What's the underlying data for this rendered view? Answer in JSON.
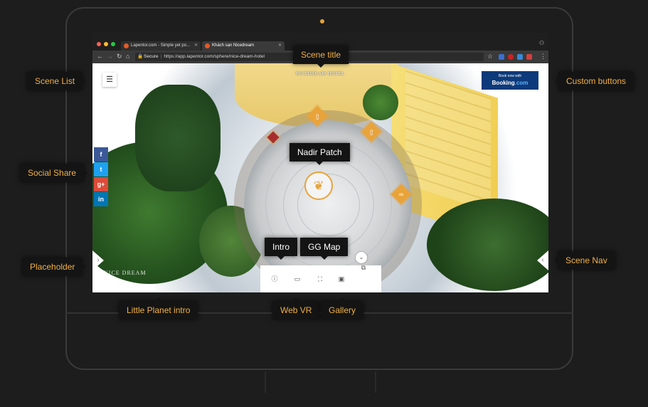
{
  "browser": {
    "tabs": [
      {
        "title": "Lapentor.com - Simple yet po..."
      },
      {
        "title": "Khách sạn Nicedream"
      }
    ],
    "secure_label": "Secure",
    "url": "https://app.lapentor.com/sphere/nice-dream-hotel"
  },
  "scene": {
    "title": "NICEDREAM HOTEL",
    "watermark": "NICE DREAM",
    "booking": {
      "small_text": "Book now with",
      "brand": "Booking",
      "tld": ".com"
    },
    "social": [
      {
        "icon": "facebook-icon",
        "glyph": "f",
        "color": "#3b5998"
      },
      {
        "icon": "twitter-icon",
        "glyph": "t",
        "color": "#1da1f2"
      },
      {
        "icon": "google-plus-icon",
        "glyph": "g+",
        "color": "#dd4b39"
      },
      {
        "icon": "linkedin-icon",
        "glyph": "in",
        "color": "#0077b5"
      }
    ],
    "bottom_icons": [
      "info-icon",
      "vr-icon",
      "map-icon",
      "gallery-icon"
    ]
  },
  "callouts": {
    "scene_title": "Scene title",
    "scene_list": "Scene List",
    "custom_buttons": "Custom buttons",
    "nadir_patch": "Nadir Patch",
    "social_share": "Social Share",
    "intro": "Intro",
    "gg_map": "GG Map",
    "placeholder": "Placeholder",
    "scene_nav": "Scene Nav",
    "little_planet_intro": "Little Planet  intro",
    "web_vr": "Web VR",
    "gallery": "Gallery"
  },
  "colors": {
    "accent": "#f0b045",
    "hotspot": "#e8a33a",
    "booking_bg": "#0d3a7a"
  }
}
